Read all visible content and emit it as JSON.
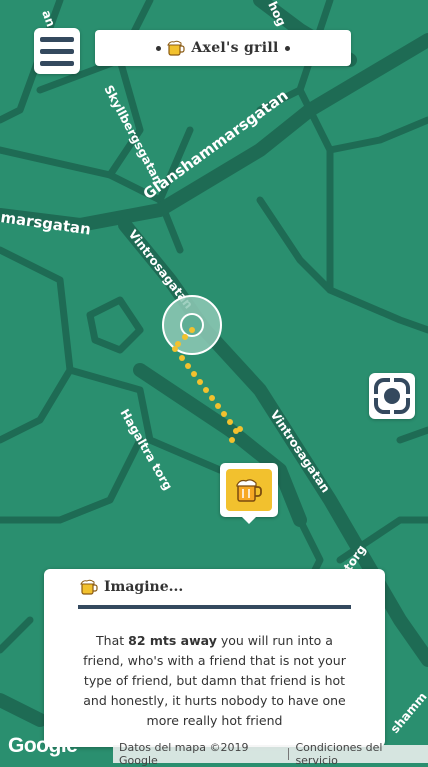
{
  "header": {
    "title": "Axel's grill",
    "logo_icon": "beer-mug-icon"
  },
  "map": {
    "streets": {
      "skyllberg": "Skyllbergsgatan",
      "glansham": "Glanshammarsgatan",
      "marsgatan": "marsgatan",
      "vintro_upper": "Vintrosagatan",
      "vintro_lower": "Vintrosagatan",
      "hagaltra": "Hagaltra torg",
      "top_left": "an",
      "top_mid": "hog",
      "bottom_torg": "torg",
      "bottom_right": "shamm"
    },
    "colors": {
      "land": "#2a8f6f",
      "road": "#1e6b54",
      "accent": "#f2c12e",
      "navy": "#34495e"
    }
  },
  "card": {
    "title": "Imagine...",
    "pre": "That ",
    "distance": "82 mts away",
    "body": " you will run into a friend, who's with a friend that is not your type of friend, but damn that friend is hot and honestly, it hurts nobody to have one more really hot friend"
  },
  "footer": {
    "logo": "Google",
    "map_data": "Datos del mapa ©2019 Google",
    "terms": "Condiciones del servicio"
  }
}
